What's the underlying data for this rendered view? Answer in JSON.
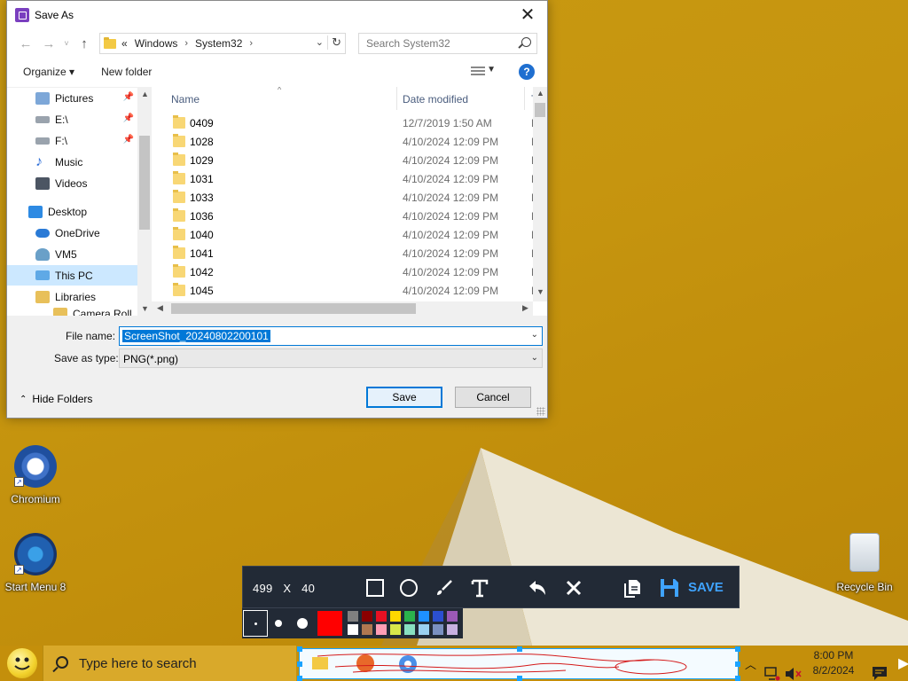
{
  "dialog": {
    "title": "Save As",
    "breadcrumb": {
      "overflow": "«",
      "items": [
        "Windows",
        "System32"
      ]
    },
    "search_placeholder": "Search System32",
    "toolbar": {
      "organize": "Organize ▾",
      "new_folder": "New folder"
    },
    "nav_items": [
      {
        "label": "Pictures",
        "icon": "pictures-icon",
        "pinned": true
      },
      {
        "label": "E:\\",
        "icon": "drive-icon",
        "pinned": true
      },
      {
        "label": "F:\\",
        "icon": "drive-icon",
        "pinned": true
      },
      {
        "label": "Music",
        "icon": "music-icon",
        "pinned": false
      },
      {
        "label": "Videos",
        "icon": "videos-icon",
        "pinned": false
      },
      {
        "label": "Desktop",
        "icon": "desktop-icon",
        "pinned": false
      },
      {
        "label": "OneDrive",
        "icon": "cloud-icon",
        "pinned": false
      },
      {
        "label": "VM5",
        "icon": "user-icon",
        "pinned": false
      },
      {
        "label": "This PC",
        "icon": "computer-icon",
        "pinned": false,
        "selected": true
      },
      {
        "label": "Libraries",
        "icon": "libraries-icon",
        "pinned": false
      },
      {
        "label": "Camera Roll",
        "icon": "folder-icon",
        "pinned": false
      }
    ],
    "columns": {
      "name": "Name",
      "date": "Date modified",
      "type": "Ty"
    },
    "files": [
      {
        "name": "0409",
        "date": "12/7/2019 1:50 AM",
        "type": "Fi"
      },
      {
        "name": "1028",
        "date": "4/10/2024 12:09 PM",
        "type": "Fi"
      },
      {
        "name": "1029",
        "date": "4/10/2024 12:09 PM",
        "type": "Fi"
      },
      {
        "name": "1031",
        "date": "4/10/2024 12:09 PM",
        "type": "Fi"
      },
      {
        "name": "1033",
        "date": "4/10/2024 12:09 PM",
        "type": "Fi"
      },
      {
        "name": "1036",
        "date": "4/10/2024 12:09 PM",
        "type": "Fi"
      },
      {
        "name": "1040",
        "date": "4/10/2024 12:09 PM",
        "type": "Fi"
      },
      {
        "name": "1041",
        "date": "4/10/2024 12:09 PM",
        "type": "Fi"
      },
      {
        "name": "1042",
        "date": "4/10/2024 12:09 PM",
        "type": "Fi"
      },
      {
        "name": "1045",
        "date": "4/10/2024 12:09 PM",
        "type": "Fi"
      }
    ],
    "file_name_label": "File name:",
    "file_name_value": "ScreenShot_20240802200101",
    "save_type_label": "Save as type:",
    "save_type_value": "PNG(*.png)",
    "hide_folders": "Hide Folders",
    "save_button": "Save",
    "cancel_button": "Cancel"
  },
  "desktop_icons": [
    {
      "label": "Chromium",
      "icon": "chromium-icon"
    },
    {
      "label": "Start Menu 8",
      "icon": "windows-logo-icon"
    },
    {
      "label": "Recycle Bin",
      "icon": "recycle-bin-icon"
    }
  ],
  "screenshot_toolbar": {
    "width": "499",
    "x_sep": "X",
    "height": "40",
    "save_label": "SAVE",
    "current_color": "#ff0000",
    "swatches_top": [
      "#808080",
      "#8b0000",
      "#e81123",
      "#ffd800",
      "#2bb24c",
      "#1e90ff",
      "#2b4fd0",
      "#9b59b6"
    ],
    "swatches_bottom": [
      "#ffffff",
      "#b07850",
      "#ff9eb5",
      "#d8e84a",
      "#88e0c0",
      "#9ad0f0",
      "#7a90c0",
      "#c8b0e0"
    ]
  },
  "taskbar": {
    "search_placeholder": "Type here to search",
    "time": "8:00 PM",
    "date": "8/2/2024"
  }
}
